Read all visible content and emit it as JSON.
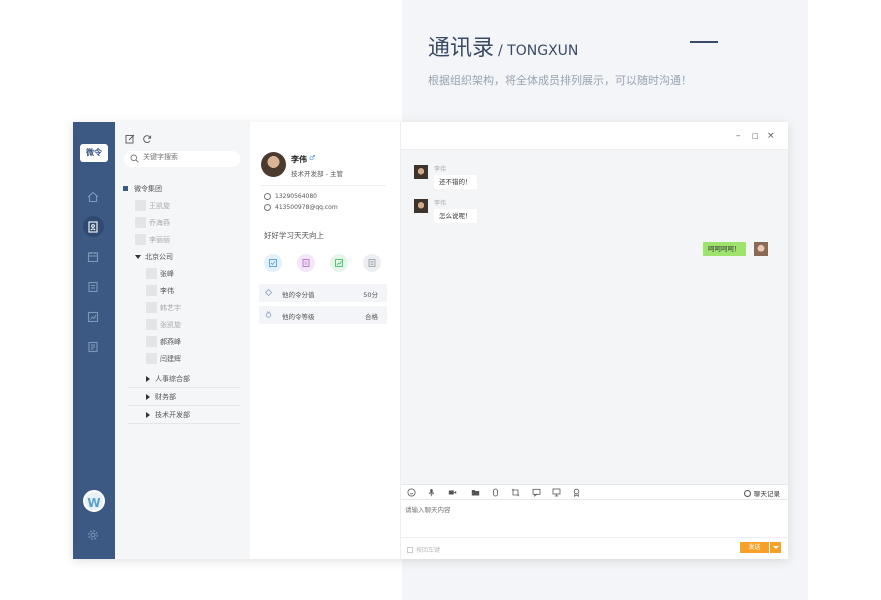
{
  "promo": {
    "title": "通讯录",
    "subtitle": "/ TONGXUN",
    "description": "根据组织架构，将全体成员排列展示，可以随时沟通！"
  },
  "app": {
    "logo_text": "微令",
    "user_avatar_letter": "W"
  },
  "search": {
    "placeholder": "关键字搜索"
  },
  "tree": {
    "root": "微令集团",
    "root_members": [
      "王凯旋",
      "乔海燕",
      "李丽丽"
    ],
    "branch": "北京公司",
    "branch_members": [
      "张峰",
      "李伟",
      "韩艺宇",
      "张凯旋",
      "郝燕峰",
      "闫建辉"
    ],
    "departments": [
      "人事综合部",
      "财务部",
      "技术开发部"
    ]
  },
  "profile": {
    "name": "李伟",
    "gender_symbol": "♂",
    "department": "技术开发部 - 主管",
    "phone": "13290564080",
    "email": "413500978@qq.com",
    "signature": "好好学习天天向上",
    "stats": [
      {
        "label": "他的令分值",
        "value": "50分"
      },
      {
        "label": "他的令等级",
        "value": "合格"
      }
    ]
  },
  "chat": {
    "window_controls": {
      "minimize": "–",
      "maximize": "□",
      "close": "×"
    },
    "messages": [
      {
        "sender": "李伟",
        "text": "还不错的！",
        "side": "left"
      },
      {
        "sender": "李伟",
        "text": "怎么说呢！",
        "side": "left"
      },
      {
        "sender": "",
        "text": "呵呵呵呵！",
        "side": "right"
      }
    ],
    "history_label": "聊天记录",
    "input_placeholder": "请输入聊天内容",
    "enter_send_label": "按回车键",
    "send_label": "发送"
  },
  "colors": {
    "nav_bg": "#3c5983",
    "send_button": "#f5a128",
    "own_bubble": "#9de36e"
  }
}
